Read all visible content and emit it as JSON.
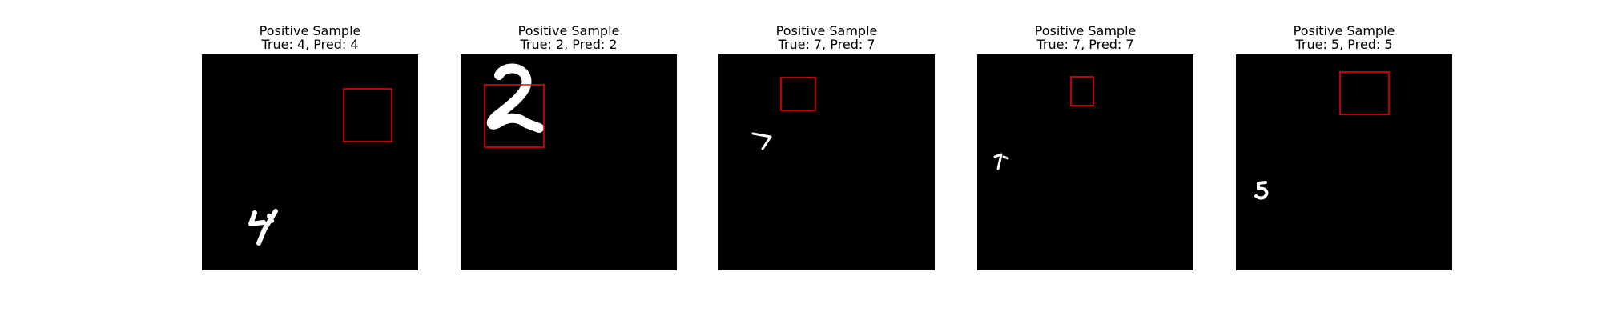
{
  "panels": [
    {
      "title": "Positive Sample",
      "subtitle": "True: 4, Pred: 4",
      "digit": "4",
      "box_color": "#ff0000"
    },
    {
      "title": "Positive Sample",
      "subtitle": "True: 2, Pred: 2",
      "digit": "2",
      "box_color": "#ff0000"
    },
    {
      "title": "Positive Sample",
      "subtitle": "True: 7, Pred: 7",
      "digit": "7",
      "box_color": "#ff0000"
    },
    {
      "title": "Positive Sample",
      "subtitle": "True: 7, Pred: 7",
      "digit": "7",
      "box_color": "#ff0000"
    },
    {
      "title": "Positive Sample",
      "subtitle": "True: 5, Pred: 5",
      "digit": "5",
      "box_color": "#ff0000"
    }
  ]
}
